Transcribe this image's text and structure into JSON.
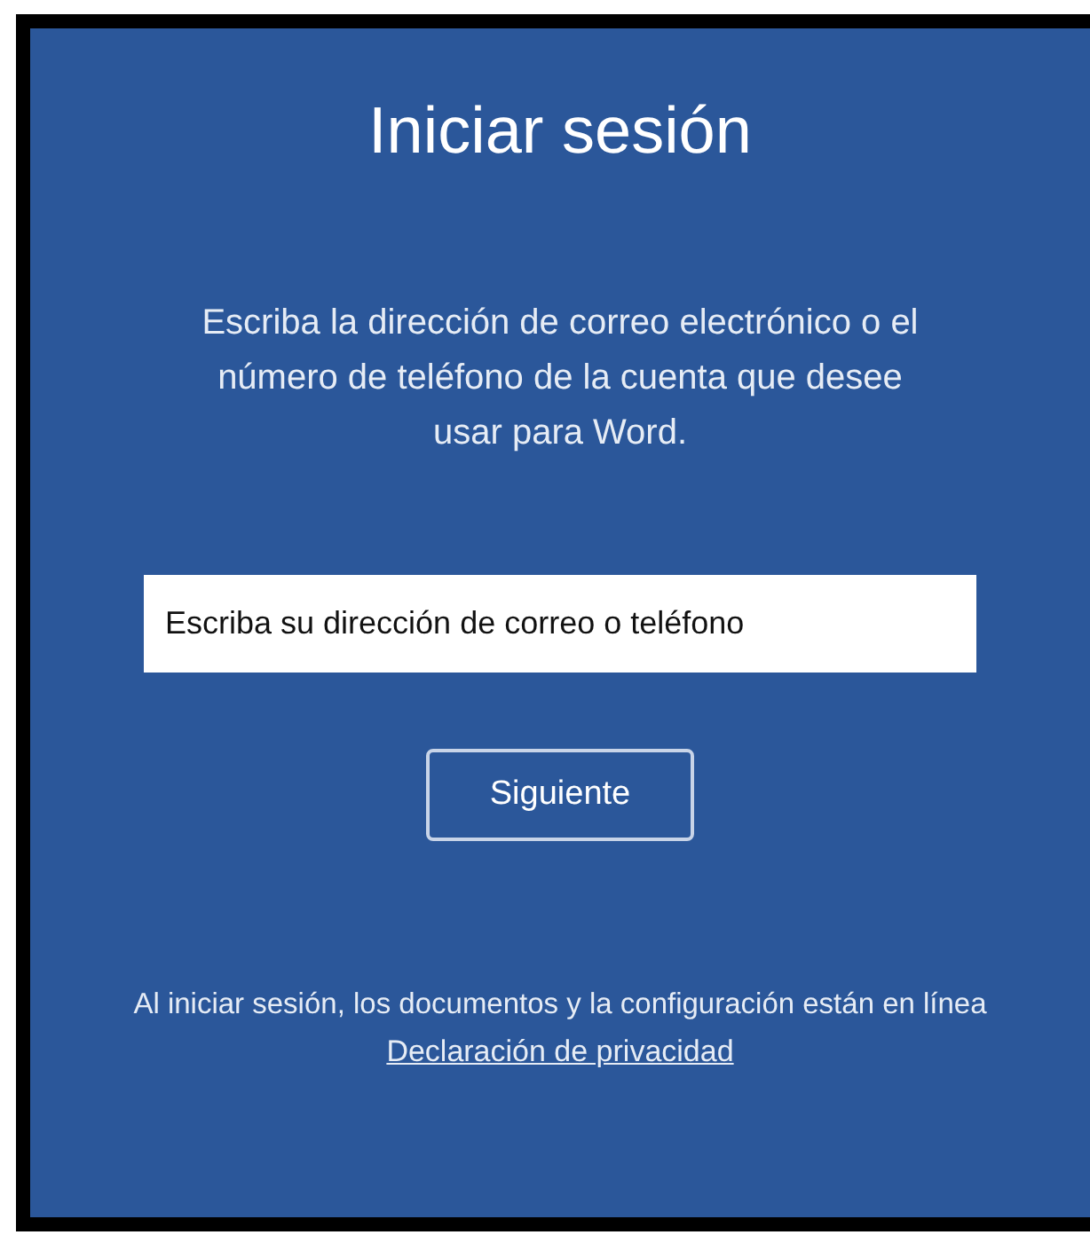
{
  "title": "Iniciar sesión",
  "message": "Escriba la dirección de correo electrónico o el número de teléfono de la cuenta que desee usar para Word.",
  "email_field": {
    "placeholder": "Escriba su dirección de correo o teléfono"
  },
  "next_button": "Siguiente",
  "footer_note": "Al iniciar sesión, los documentos y la configuración están en línea",
  "privacy_link": "Declaración de privacidad"
}
